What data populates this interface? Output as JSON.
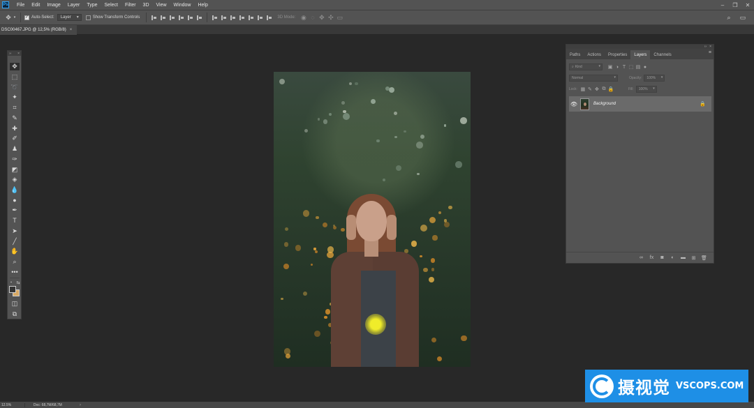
{
  "app": {
    "logo": "Ps"
  },
  "menu": [
    "File",
    "Edit",
    "Image",
    "Layer",
    "Type",
    "Select",
    "Filter",
    "3D",
    "View",
    "Window",
    "Help"
  ],
  "options_bar": {
    "auto_select_label": "Auto-Select:",
    "auto_select_target": "Layer",
    "show_transform_label": "Show Transform Controls",
    "mode_3d_label": "3D Mode:"
  },
  "document_tab": {
    "title": "DSC00467.JPG @ 12,5% (RGB/8)",
    "close": "×"
  },
  "layers_panel": {
    "tabs": [
      "Paths",
      "Actions",
      "Properties",
      "Layers",
      "Channels"
    ],
    "active_tab": "Layers",
    "filter_kind": "Kind",
    "blend_mode": "Normal",
    "opacity_label": "Opacity:",
    "opacity_value": "100%",
    "lock_label": "Lock:",
    "fill_label": "Fill:",
    "fill_value": "100%",
    "layers": [
      {
        "name": "Background",
        "visible": true,
        "locked": true
      }
    ]
  },
  "status_bar": {
    "zoom": "12.5%",
    "doc_size": "Doc: 68,7M/68,7M",
    "arrow": "›"
  },
  "watermark": {
    "cn": "摄视觉",
    "en": "VSCOPS.COM"
  },
  "colors": {
    "highlight": "#f5f021",
    "foreground": "#333333",
    "background": "#d9a964",
    "watermark_bg": "#1e8fe6"
  }
}
